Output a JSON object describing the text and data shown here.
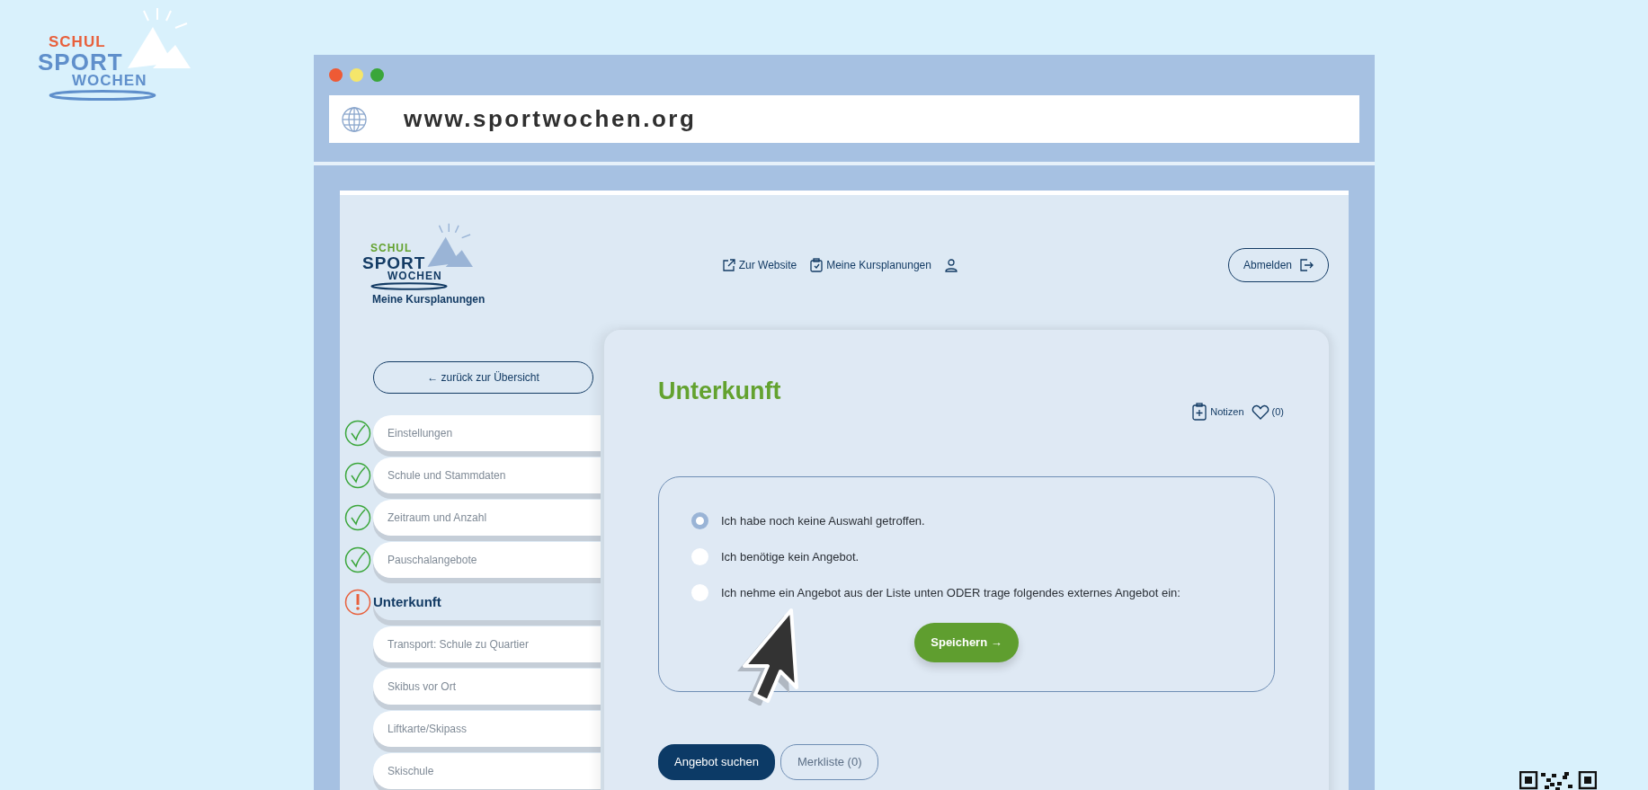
{
  "brand_logo": {
    "line_1": "SCHUL",
    "line_2": "SPORT",
    "line_3": "WOCHEN"
  },
  "browser": {
    "address": "www.sportwochen.org"
  },
  "app_header": {
    "logo": {
      "line_1": "SCHUL",
      "line_2": "SPORT",
      "line_3": "WOCHEN"
    },
    "subtitle": "Meine Kursplanungen",
    "nav": [
      {
        "kind": "external",
        "label": "Zur Website"
      },
      {
        "kind": "clipboard",
        "label": "Meine Kursplanungen"
      },
      {
        "kind": "user"
      }
    ],
    "logout": "Abmelden"
  },
  "back_button": "← zurück zur Übersicht",
  "steps": [
    {
      "label": "Einstellungen",
      "kind": "done",
      "selected": false
    },
    {
      "label": "Schule und Stammdaten",
      "kind": "done",
      "selected": false
    },
    {
      "label": "Zeitraum und Anzahl",
      "kind": "done",
      "selected": false
    },
    {
      "label": "Pauschalangebote",
      "kind": "done",
      "selected": false
    },
    {
      "label": "Unterkunft",
      "kind": "warning",
      "selected": true
    },
    {
      "label": "Transport: Schule zu Quartier",
      "kind": "open",
      "selected": false
    },
    {
      "label": "Skibus vor Ort",
      "kind": "open",
      "selected": false
    },
    {
      "label": "Liftkarte/Skipass",
      "kind": "open",
      "selected": false
    },
    {
      "label": "Skischule",
      "kind": "open",
      "selected": false
    }
  ],
  "main": {
    "title": "Unterkunft",
    "notes": "Notizen",
    "favorites": "(0)",
    "options": [
      {
        "label": "Ich habe noch keine Auswahl getroffen.",
        "selected": true
      },
      {
        "label": "Ich benötige kein Angebot.",
        "selected": false
      },
      {
        "label": "Ich nehme ein Angebot aus der Liste unten ODER trage folgendes externes Angebot ein:",
        "selected": false
      }
    ],
    "save": "Speichern →",
    "search": "Angebot suchen",
    "watchlist": "Merkliste (0)"
  }
}
